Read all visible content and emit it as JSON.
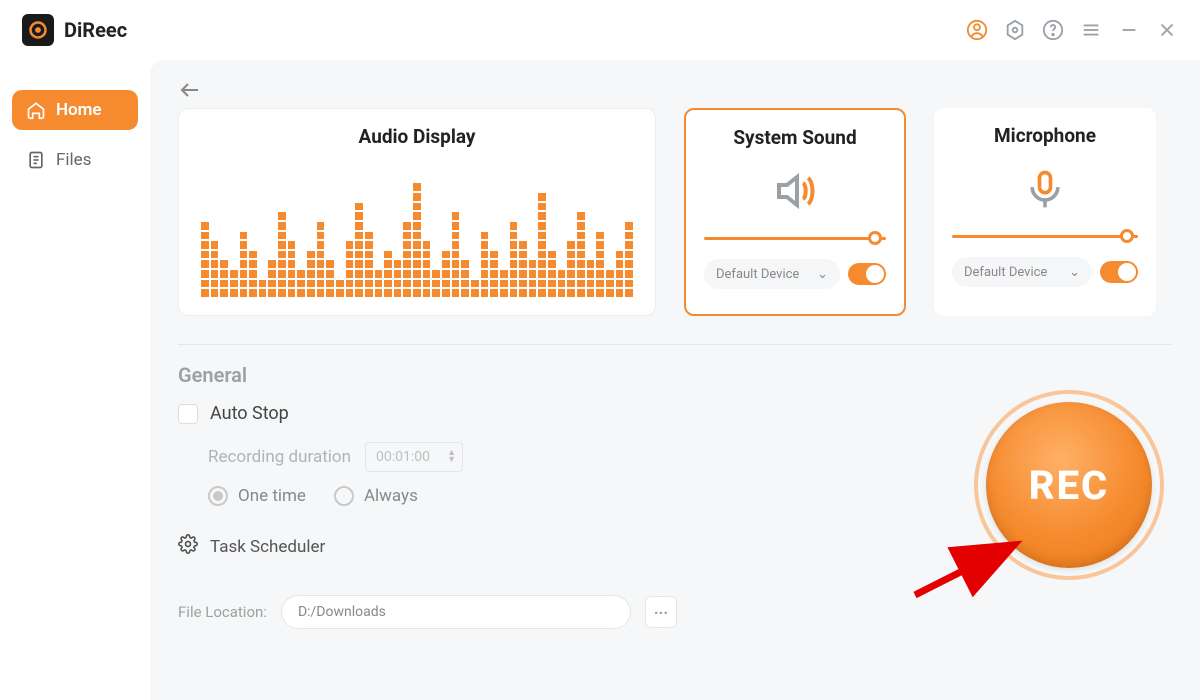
{
  "brand": {
    "name": "DiReec"
  },
  "sidebar": {
    "items": [
      {
        "label": "Home"
      },
      {
        "label": "Files"
      }
    ]
  },
  "cards": {
    "audio": {
      "title": "Audio Display"
    },
    "system": {
      "title": "System Sound",
      "device": "Default Device"
    },
    "mic": {
      "title": "Microphone",
      "device": "Default Device"
    }
  },
  "general": {
    "title": "General",
    "auto_stop": "Auto Stop",
    "recording_duration": "Recording duration",
    "duration_value": "00:01:00",
    "one_time": "One time",
    "always": "Always",
    "task_scheduler": "Task Scheduler"
  },
  "file": {
    "label": "File Location:",
    "path": "D:/Downloads"
  },
  "rec": {
    "label": "REC"
  },
  "audio_bars": [
    8,
    6,
    4,
    3,
    7,
    5,
    2,
    4,
    9,
    6,
    3,
    5,
    8,
    4,
    2,
    6,
    10,
    7,
    3,
    5,
    4,
    8,
    12,
    6,
    3,
    5,
    9,
    4,
    2,
    7,
    5,
    3,
    8,
    6,
    4,
    11,
    5,
    3,
    6,
    9,
    4,
    7,
    3,
    5,
    8
  ]
}
